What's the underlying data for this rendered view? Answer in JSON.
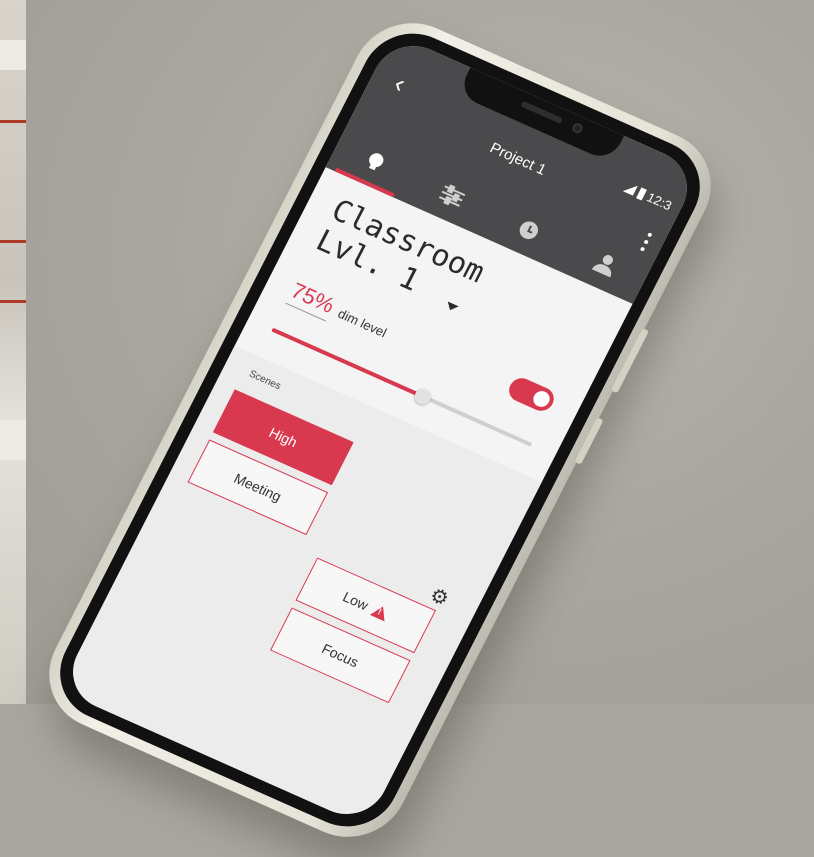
{
  "appbar": {
    "title": "Project 1",
    "status_time": "12:3",
    "tabs": [
      {
        "name": "lights",
        "icon": "bulb-icon",
        "active": true
      },
      {
        "name": "controls",
        "icon": "sliders-icon",
        "active": false
      },
      {
        "name": "schedule",
        "icon": "clock-icon",
        "active": false
      },
      {
        "name": "profile",
        "icon": "person-icon",
        "active": false
      }
    ]
  },
  "room": {
    "line1": "Classroom",
    "line2": "Lvl. 1"
  },
  "dim": {
    "value": "75%",
    "label": "dim level",
    "level": 0.58
  },
  "power_on": true,
  "scenes": {
    "label": "Scenes",
    "items": [
      {
        "label": "High",
        "active": true
      },
      {
        "label": "Meeting",
        "active": false
      },
      {
        "label": "Low",
        "active": false,
        "warning": true
      },
      {
        "label": "Focus",
        "active": false
      }
    ]
  },
  "colors": {
    "accent": "#d9394f",
    "appbar": "#4a4a4d"
  }
}
